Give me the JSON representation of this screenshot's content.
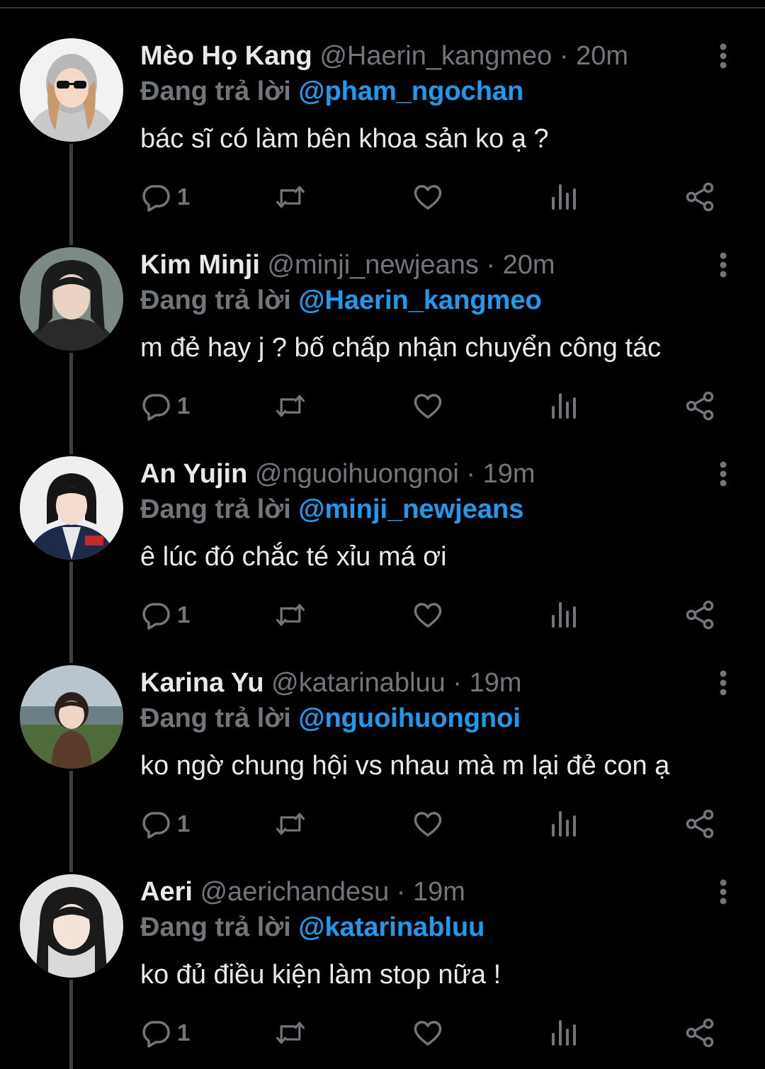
{
  "tweets": [
    {
      "name": "Mèo Họ Kang",
      "handle": "@Haerin_kangmeo",
      "dot": "·",
      "time": "20m",
      "reply_prefix": "Đang trả lời",
      "reply_to": "@pham_ngochan",
      "text": "bác sĩ có làm bên khoa sản ko ạ ?",
      "reply_count": "1"
    },
    {
      "name": "Kim Minji",
      "handle": "@minji_newjeans",
      "dot": "·",
      "time": "20m",
      "reply_prefix": "Đang trả lời",
      "reply_to": "@Haerin_kangmeo",
      "text": "m đẻ hay j ? bố chấp nhận chuyển công tác",
      "reply_count": "1"
    },
    {
      "name": "An Yujin",
      "handle": "@nguoihuongnoi",
      "dot": "·",
      "time": "19m",
      "reply_prefix": "Đang trả lời",
      "reply_to": "@minji_newjeans",
      "text": "ê lúc đó chắc té xỉu má ơi",
      "reply_count": "1"
    },
    {
      "name": "Karina Yu",
      "handle": "@katarinabluu",
      "dot": "·",
      "time": "19m",
      "reply_prefix": "Đang trả lời",
      "reply_to": "@nguoihuongnoi",
      "text": "ko ngờ chung hội vs nhau mà m lại đẻ con ạ",
      "reply_count": "1"
    },
    {
      "name": "Aeri",
      "handle": "@aerichandesu",
      "dot": "·",
      "time": "19m",
      "reply_prefix": "Đang trả lời",
      "reply_to": "@katarinabluu",
      "text": "ko đủ điều kiện làm stop nữa !",
      "reply_count": "1"
    }
  ],
  "icons": {
    "reply": "reply-icon",
    "retweet": "retweet-icon",
    "like": "heart-icon",
    "views": "views-icon",
    "share": "share-icon",
    "more": "more-vertical-icon"
  },
  "colors": {
    "background": "#000000",
    "text": "#e7e9ea",
    "muted": "#71767b",
    "link": "#1d9bf0",
    "thread_line": "#3a3f44"
  }
}
